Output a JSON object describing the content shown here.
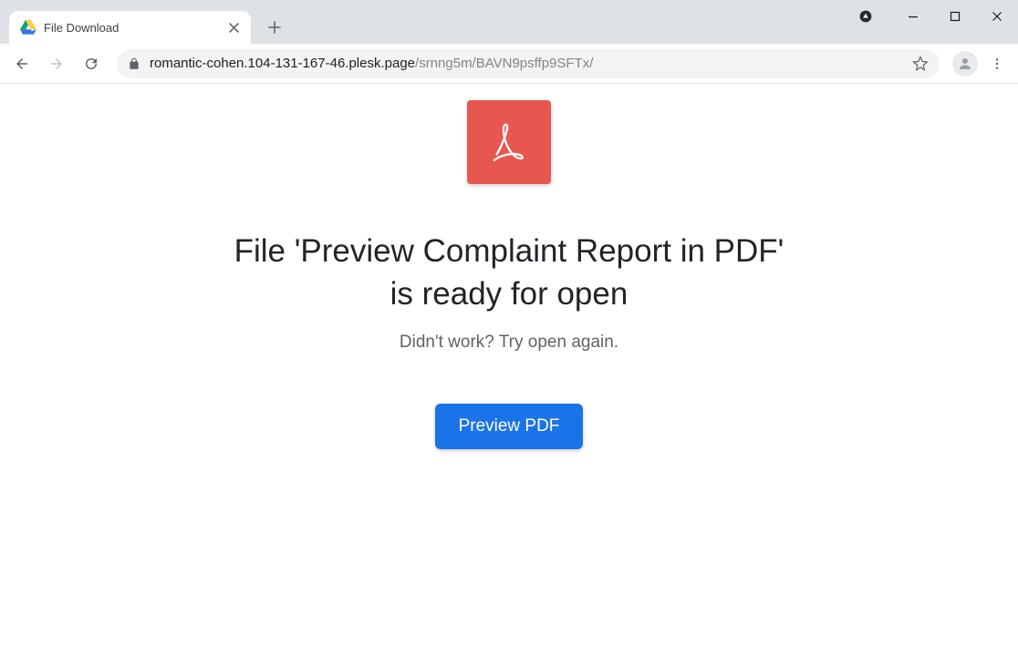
{
  "browser": {
    "tab_title": "File Download",
    "url_host": "romantic-cohen.104-131-167-46.plesk.page",
    "url_path": "/srnng5m/BAVN9psffp9SFTx/"
  },
  "page": {
    "heading_line1": "File 'Preview Complaint Report in PDF'",
    "heading_line2": "is ready for open",
    "sub_message": "Didn't work? Try open again.",
    "button_label": "Preview PDF"
  },
  "icons": {
    "pdf": "acrobat-icon",
    "drive": "google-drive-icon"
  },
  "colors": {
    "pdf_block": "#e8574f",
    "primary_button": "#1a73e8"
  }
}
